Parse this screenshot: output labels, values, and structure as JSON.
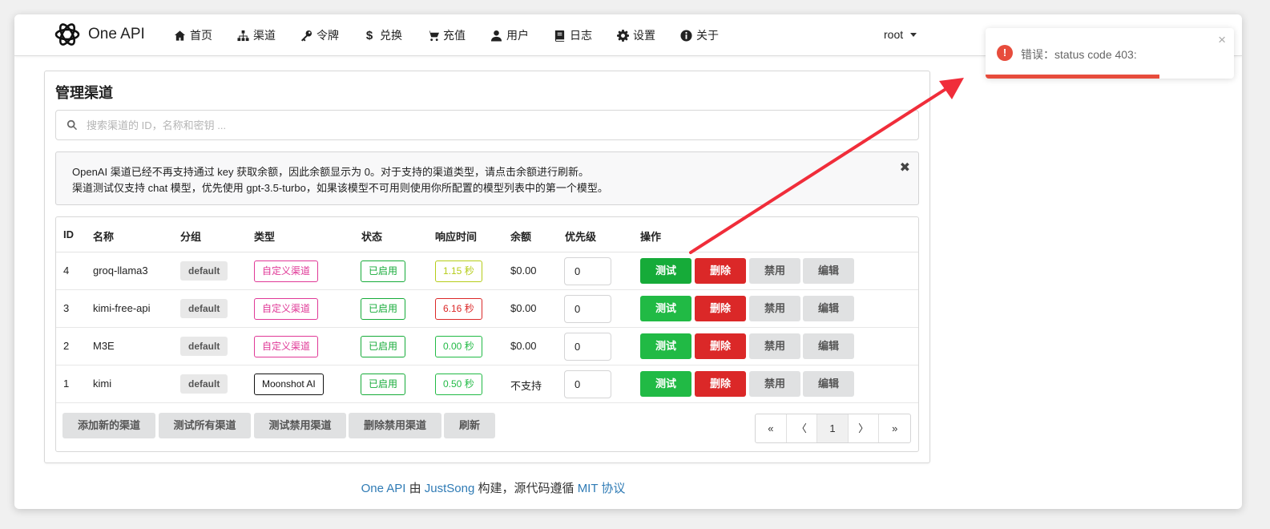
{
  "app": {
    "brand_name": "One API"
  },
  "nav": {
    "items": [
      {
        "label": "首页",
        "icon": "home-icon"
      },
      {
        "label": "渠道",
        "icon": "sitemap-icon"
      },
      {
        "label": "令牌",
        "icon": "key-icon"
      },
      {
        "label": "兑换",
        "icon": "dollar-icon"
      },
      {
        "label": "充值",
        "icon": "cart-icon"
      },
      {
        "label": "用户",
        "icon": "user-icon"
      },
      {
        "label": "日志",
        "icon": "book-icon"
      },
      {
        "label": "设置",
        "icon": "gear-icon"
      },
      {
        "label": "关于",
        "icon": "info-icon"
      }
    ],
    "user": "root"
  },
  "page": {
    "title": "管理渠道",
    "search_placeholder": "搜索渠道的 ID，名称和密钥 ...",
    "notice_line1": "OpenAI 渠道已经不再支持通过 key 获取余额，因此余额显示为 0。对于支持的渠道类型，请点击余额进行刷新。",
    "notice_line2": "渠道测试仅支持 chat 模型，优先使用 gpt-3.5-turbo，如果该模型不可用则使用你所配置的模型列表中的第一个模型。",
    "notice_close": "✖"
  },
  "table": {
    "headers": {
      "id": "ID",
      "name": "名称",
      "group": "分组",
      "type": "类型",
      "status": "状态",
      "response_time": "响应时间",
      "balance": "余额",
      "priority": "优先级",
      "actions": "操作"
    },
    "rows": [
      {
        "id": "4",
        "name": "groq-llama3",
        "group": "default",
        "type": "自定义渠道",
        "status": "已启用",
        "response_time": "1.15 秒",
        "balance": "$0.00",
        "priority": "0"
      },
      {
        "id": "3",
        "name": "kimi-free-api",
        "group": "default",
        "type": "自定义渠道",
        "status": "已启用",
        "response_time": "6.16 秒",
        "balance": "$0.00",
        "priority": "0"
      },
      {
        "id": "2",
        "name": "M3E",
        "group": "default",
        "type": "自定义渠道",
        "status": "已启用",
        "response_time": "0.00 秒",
        "balance": "$0.00",
        "priority": "0"
      },
      {
        "id": "1",
        "name": "kimi",
        "group": "default",
        "type": "Moonshot AI",
        "status": "已启用",
        "response_time": "0.50 秒",
        "balance": "不支持",
        "priority": "0"
      }
    ],
    "row_actions": {
      "test": "测试",
      "delete": "删除",
      "disable": "禁用",
      "edit": "编辑"
    },
    "footer_buttons": {
      "add": "添加新的渠道",
      "test_all": "测试所有渠道",
      "test_disabled": "测试禁用渠道",
      "delete_disabled": "删除禁用渠道",
      "refresh": "刷新"
    },
    "pagination": {
      "first": "«",
      "prev": "〈",
      "current": "1",
      "next": "〉",
      "last": "»"
    }
  },
  "footer": {
    "link1": "One API",
    "text1": " 由 ",
    "link2": "JustSong",
    "text2": " 构建，源代码遵循 ",
    "link3": "MIT 协议"
  },
  "toast": {
    "message": "错误：status code 403:",
    "close": "×",
    "progress_fraction": 0.7
  },
  "colors": {
    "success": "#21ba45",
    "danger": "#db2828",
    "pink": "#e03997",
    "olive": "#b5cc18",
    "toast_error": "#e74c3c",
    "link": "#2f7bb5",
    "arrow": "#f02d3a"
  }
}
